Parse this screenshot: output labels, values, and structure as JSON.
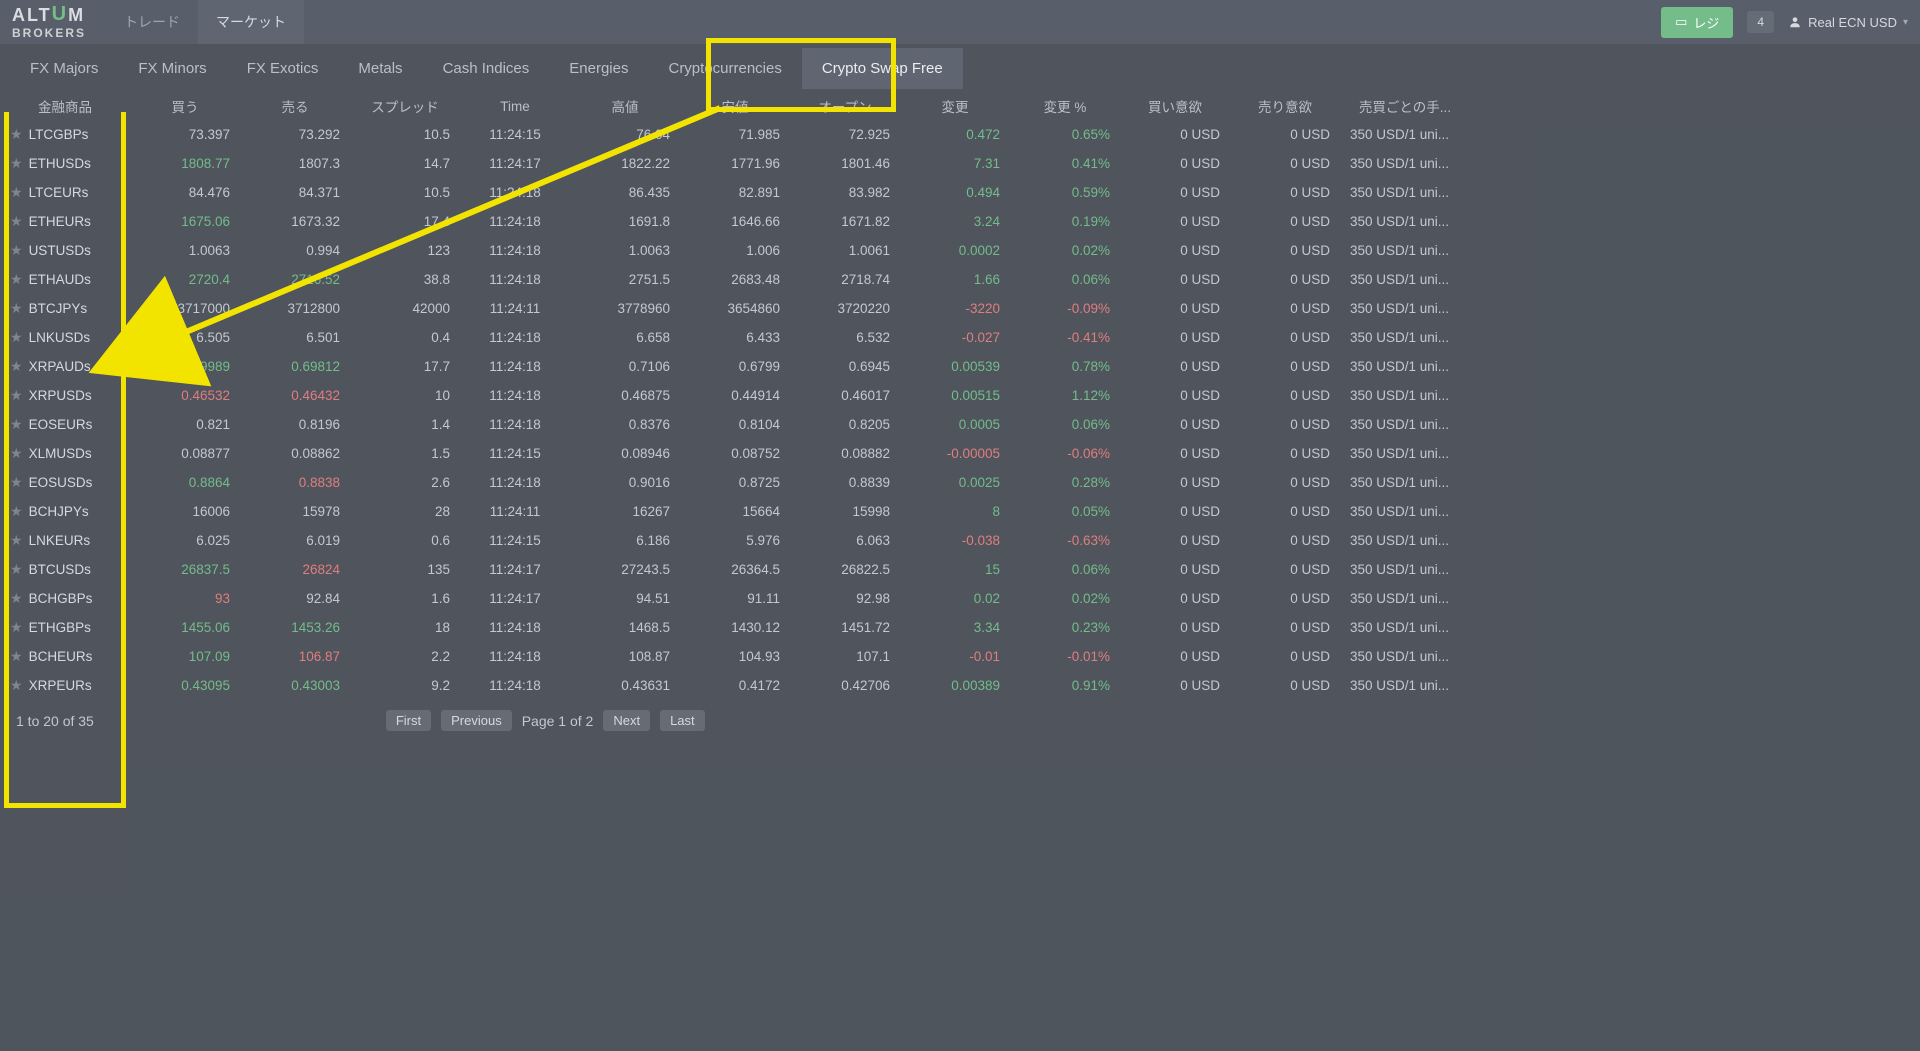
{
  "header": {
    "logo_top": "ALT",
    "logo_u": "U",
    "logo_m": "M",
    "logo_bottom": "BROKERS",
    "tab_trade": "トレード",
    "tab_market": "マーケット",
    "deposit_label": "レジ",
    "notif_count": "4",
    "account_label": "Real ECN USD"
  },
  "cats": {
    "fx_majors": "FX Majors",
    "fx_minors": "FX Minors",
    "fx_exotics": "FX Exotics",
    "metals": "Metals",
    "cash_indices": "Cash Indices",
    "energies": "Energies",
    "crypto": "Cryptocurrencies",
    "crypto_swap_free": "Crypto Swap Free"
  },
  "cols": {
    "symbol": "金融商品",
    "buy": "買う",
    "sell": "売る",
    "spread": "スプレッド",
    "time": "Time",
    "high": "高値",
    "low": "安値",
    "open": "オープン",
    "change": "変更",
    "change_pct": "変更 %",
    "long_swap": "買い意欲",
    "short_swap": "売り意欲",
    "comm": "売買ごとの手..."
  },
  "rows": [
    {
      "sym": "LTCGBPs",
      "buy": "73.397",
      "bc": "n",
      "sell": "73.292",
      "sc": "n",
      "spread": "10.5",
      "time": "11:24:15",
      "high": "76.04",
      "low": "71.985",
      "open": "72.925",
      "chg": "0.472",
      "chc": "g",
      "pct": "0.65%",
      "pc": "g",
      "ls": "0 USD",
      "ss": "0 USD",
      "cm": "350 USD/1 uni..."
    },
    {
      "sym": "ETHUSDs",
      "buy": "1808.77",
      "bc": "g",
      "sell": "1807.3",
      "sc": "n",
      "spread": "14.7",
      "time": "11:24:17",
      "high": "1822.22",
      "low": "1771.96",
      "open": "1801.46",
      "chg": "7.31",
      "chc": "g",
      "pct": "0.41%",
      "pc": "g",
      "ls": "0 USD",
      "ss": "0 USD",
      "cm": "350 USD/1 uni..."
    },
    {
      "sym": "LTCEURs",
      "buy": "84.476",
      "bc": "n",
      "sell": "84.371",
      "sc": "n",
      "spread": "10.5",
      "time": "11:24:18",
      "high": "86.435",
      "low": "82.891",
      "open": "83.982",
      "chg": "0.494",
      "chc": "g",
      "pct": "0.59%",
      "pc": "g",
      "ls": "0 USD",
      "ss": "0 USD",
      "cm": "350 USD/1 uni..."
    },
    {
      "sym": "ETHEURs",
      "buy": "1675.06",
      "bc": "g",
      "sell": "1673.32",
      "sc": "n",
      "spread": "17.4",
      "time": "11:24:18",
      "high": "1691.8",
      "low": "1646.66",
      "open": "1671.82",
      "chg": "3.24",
      "chc": "g",
      "pct": "0.19%",
      "pc": "g",
      "ls": "0 USD",
      "ss": "0 USD",
      "cm": "350 USD/1 uni..."
    },
    {
      "sym": "USTUSDs",
      "buy": "1.0063",
      "bc": "n",
      "sell": "0.994",
      "sc": "n",
      "spread": "123",
      "time": "11:24:18",
      "high": "1.0063",
      "low": "1.006",
      "open": "1.0061",
      "chg": "0.0002",
      "chc": "g",
      "pct": "0.02%",
      "pc": "g",
      "ls": "0 USD",
      "ss": "0 USD",
      "cm": "350 USD/1 uni..."
    },
    {
      "sym": "ETHAUDs",
      "buy": "2720.4",
      "bc": "g",
      "sell": "2716.52",
      "sc": "g",
      "spread": "38.8",
      "time": "11:24:18",
      "high": "2751.5",
      "low": "2683.48",
      "open": "2718.74",
      "chg": "1.66",
      "chc": "g",
      "pct": "0.06%",
      "pc": "g",
      "ls": "0 USD",
      "ss": "0 USD",
      "cm": "350 USD/1 uni..."
    },
    {
      "sym": "BTCJPYs",
      "buy": "3717000",
      "bc": "n",
      "sell": "3712800",
      "sc": "n",
      "spread": "42000",
      "time": "11:24:11",
      "high": "3778960",
      "low": "3654860",
      "open": "3720220",
      "chg": "-3220",
      "chc": "r",
      "pct": "-0.09%",
      "pc": "r",
      "ls": "0 USD",
      "ss": "0 USD",
      "cm": "350 USD/1 uni..."
    },
    {
      "sym": "LNKUSDs",
      "buy": "6.505",
      "bc": "n",
      "sell": "6.501",
      "sc": "n",
      "spread": "0.4",
      "time": "11:24:18",
      "high": "6.658",
      "low": "6.433",
      "open": "6.532",
      "chg": "-0.027",
      "chc": "r",
      "pct": "-0.41%",
      "pc": "r",
      "ls": "0 USD",
      "ss": "0 USD",
      "cm": "350 USD/1 uni..."
    },
    {
      "sym": "XRPAUDs",
      "buy": "0.69989",
      "bc": "g",
      "sell": "0.69812",
      "sc": "g",
      "spread": "17.7",
      "time": "11:24:18",
      "high": "0.7106",
      "low": "0.6799",
      "open": "0.6945",
      "chg": "0.00539",
      "chc": "g",
      "pct": "0.78%",
      "pc": "g",
      "ls": "0 USD",
      "ss": "0 USD",
      "cm": "350 USD/1 uni..."
    },
    {
      "sym": "XRPUSDs",
      "buy": "0.46532",
      "bc": "r",
      "sell": "0.46432",
      "sc": "r",
      "spread": "10",
      "time": "11:24:18",
      "high": "0.46875",
      "low": "0.44914",
      "open": "0.46017",
      "chg": "0.00515",
      "chc": "g",
      "pct": "1.12%",
      "pc": "g",
      "ls": "0 USD",
      "ss": "0 USD",
      "cm": "350 USD/1 uni..."
    },
    {
      "sym": "EOSEURs",
      "buy": "0.821",
      "bc": "n",
      "sell": "0.8196",
      "sc": "n",
      "spread": "1.4",
      "time": "11:24:18",
      "high": "0.8376",
      "low": "0.8104",
      "open": "0.8205",
      "chg": "0.0005",
      "chc": "g",
      "pct": "0.06%",
      "pc": "g",
      "ls": "0 USD",
      "ss": "0 USD",
      "cm": "350 USD/1 uni..."
    },
    {
      "sym": "XLMUSDs",
      "buy": "0.08877",
      "bc": "n",
      "sell": "0.08862",
      "sc": "n",
      "spread": "1.5",
      "time": "11:24:15",
      "high": "0.08946",
      "low": "0.08752",
      "open": "0.08882",
      "chg": "-0.00005",
      "chc": "r",
      "pct": "-0.06%",
      "pc": "r",
      "ls": "0 USD",
      "ss": "0 USD",
      "cm": "350 USD/1 uni..."
    },
    {
      "sym": "EOSUSDs",
      "buy": "0.8864",
      "bc": "g",
      "sell": "0.8838",
      "sc": "r",
      "spread": "2.6",
      "time": "11:24:18",
      "high": "0.9016",
      "low": "0.8725",
      "open": "0.8839",
      "chg": "0.0025",
      "chc": "g",
      "pct": "0.28%",
      "pc": "g",
      "ls": "0 USD",
      "ss": "0 USD",
      "cm": "350 USD/1 uni..."
    },
    {
      "sym": "BCHJPYs",
      "buy": "16006",
      "bc": "n",
      "sell": "15978",
      "sc": "n",
      "spread": "28",
      "time": "11:24:11",
      "high": "16267",
      "low": "15664",
      "open": "15998",
      "chg": "8",
      "chc": "g",
      "pct": "0.05%",
      "pc": "g",
      "ls": "0 USD",
      "ss": "0 USD",
      "cm": "350 USD/1 uni..."
    },
    {
      "sym": "LNKEURs",
      "buy": "6.025",
      "bc": "n",
      "sell": "6.019",
      "sc": "n",
      "spread": "0.6",
      "time": "11:24:15",
      "high": "6.186",
      "low": "5.976",
      "open": "6.063",
      "chg": "-0.038",
      "chc": "r",
      "pct": "-0.63%",
      "pc": "r",
      "ls": "0 USD",
      "ss": "0 USD",
      "cm": "350 USD/1 uni..."
    },
    {
      "sym": "BTCUSDs",
      "buy": "26837.5",
      "bc": "g",
      "sell": "26824",
      "sc": "r",
      "spread": "135",
      "time": "11:24:17",
      "high": "27243.5",
      "low": "26364.5",
      "open": "26822.5",
      "chg": "15",
      "chc": "g",
      "pct": "0.06%",
      "pc": "g",
      "ls": "0 USD",
      "ss": "0 USD",
      "cm": "350 USD/1 uni..."
    },
    {
      "sym": "BCHGBPs",
      "buy": "93",
      "bc": "r",
      "sell": "92.84",
      "sc": "n",
      "spread": "1.6",
      "time": "11:24:17",
      "high": "94.51",
      "low": "91.11",
      "open": "92.98",
      "chg": "0.02",
      "chc": "g",
      "pct": "0.02%",
      "pc": "g",
      "ls": "0 USD",
      "ss": "0 USD",
      "cm": "350 USD/1 uni..."
    },
    {
      "sym": "ETHGBPs",
      "buy": "1455.06",
      "bc": "g",
      "sell": "1453.26",
      "sc": "g",
      "spread": "18",
      "time": "11:24:18",
      "high": "1468.5",
      "low": "1430.12",
      "open": "1451.72",
      "chg": "3.34",
      "chc": "g",
      "pct": "0.23%",
      "pc": "g",
      "ls": "0 USD",
      "ss": "0 USD",
      "cm": "350 USD/1 uni..."
    },
    {
      "sym": "BCHEURs",
      "buy": "107.09",
      "bc": "g",
      "sell": "106.87",
      "sc": "r",
      "spread": "2.2",
      "time": "11:24:18",
      "high": "108.87",
      "low": "104.93",
      "open": "107.1",
      "chg": "-0.01",
      "chc": "r",
      "pct": "-0.01%",
      "pc": "r",
      "ls": "0 USD",
      "ss": "0 USD",
      "cm": "350 USD/1 uni..."
    },
    {
      "sym": "XRPEURs",
      "buy": "0.43095",
      "bc": "g",
      "sell": "0.43003",
      "sc": "g",
      "spread": "9.2",
      "time": "11:24:18",
      "high": "0.43631",
      "low": "0.4172",
      "open": "0.42706",
      "chg": "0.00389",
      "chc": "g",
      "pct": "0.91%",
      "pc": "g",
      "ls": "0 USD",
      "ss": "0 USD",
      "cm": "350 USD/1 uni..."
    }
  ],
  "pager": {
    "range": "1 to 20 of 35",
    "first": "First",
    "prev": "Previous",
    "info": "Page 1 of 2",
    "next": "Next",
    "last": "Last"
  }
}
